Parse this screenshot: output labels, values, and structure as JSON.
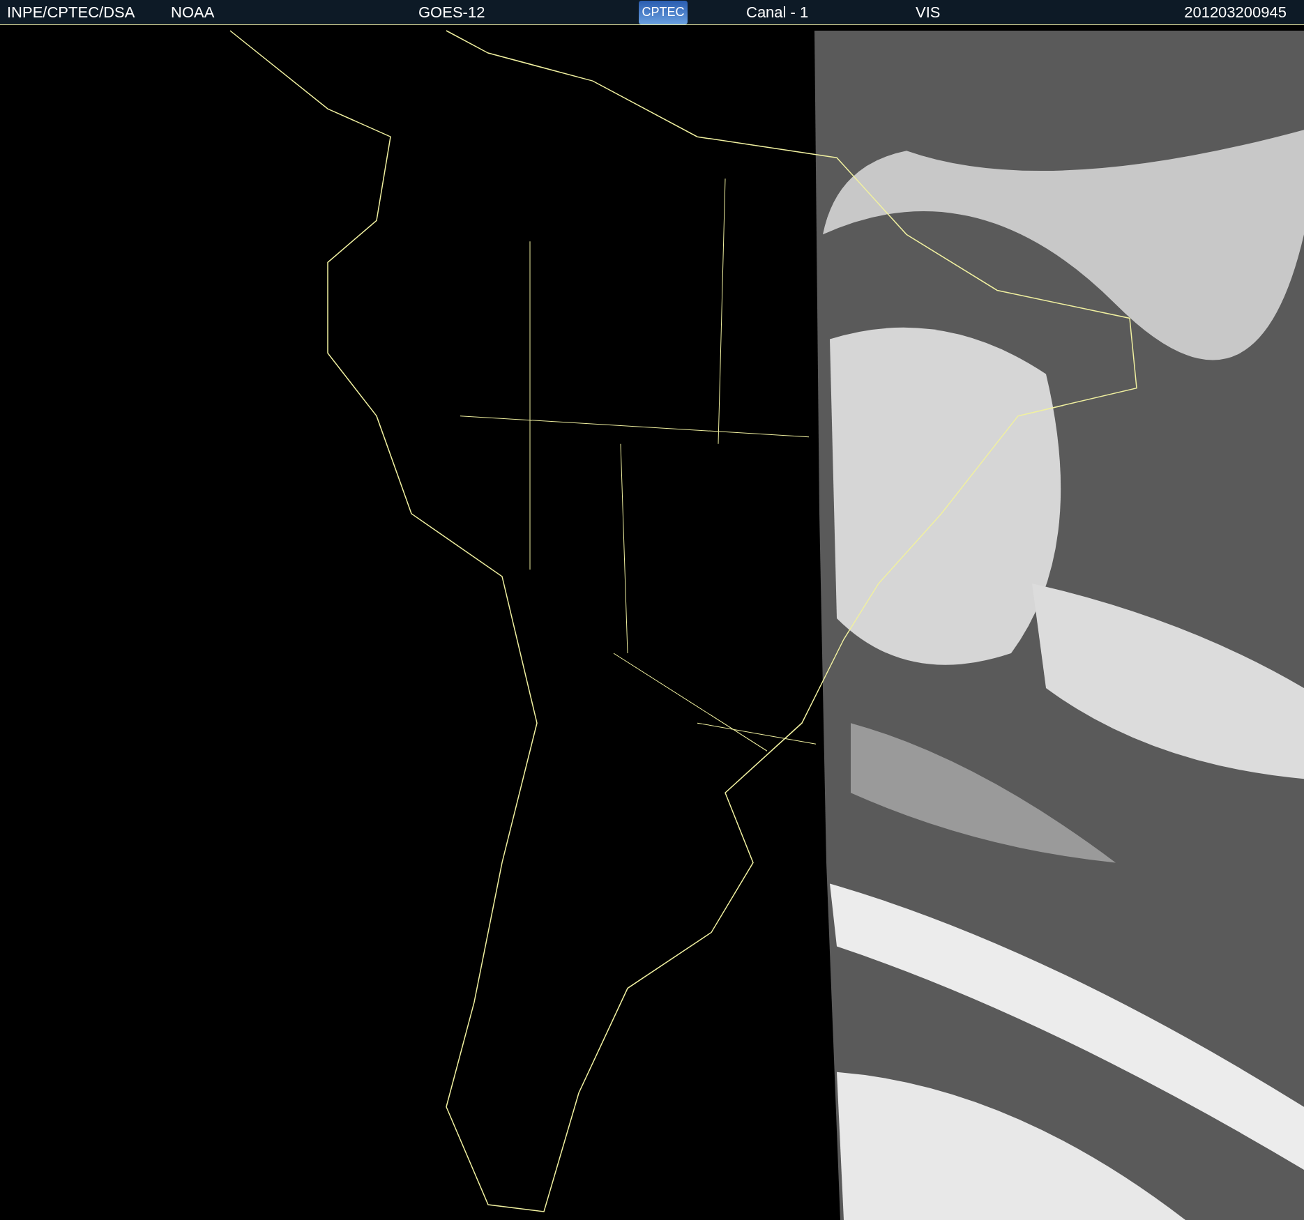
{
  "header": {
    "source": "INPE/CPTEC/DSA",
    "agency": "NOAA",
    "satellite": "GOES-12",
    "logo": "CPTEC",
    "channel": "Canal - 1",
    "band": "VIS",
    "timestamp": "201203200945"
  }
}
